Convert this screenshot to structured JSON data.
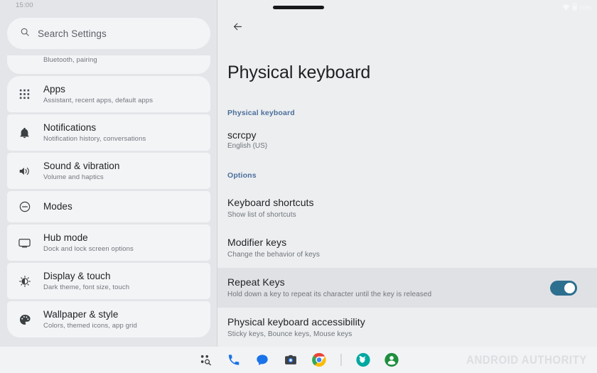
{
  "statusbar": {
    "time": "15:00",
    "battery_percent": "70%",
    "icons": [
      "wifi-icon",
      "battery-icon"
    ]
  },
  "sidebar": {
    "search": {
      "placeholder": "Search Settings",
      "icon": "search-icon"
    },
    "items": [
      {
        "id": "connected-devices",
        "icon": "bluetooth-icon",
        "title": "",
        "subtitle": "Bluetooth, pairing",
        "partial": true
      },
      {
        "id": "apps",
        "icon": "apps-grid-icon",
        "title": "Apps",
        "subtitle": "Assistant, recent apps, default apps"
      },
      {
        "id": "notifications",
        "icon": "bell-icon",
        "title": "Notifications",
        "subtitle": "Notification history, conversations"
      },
      {
        "id": "sound-vibration",
        "icon": "volume-icon",
        "title": "Sound & vibration",
        "subtitle": "Volume and haptics"
      },
      {
        "id": "modes",
        "icon": "do-not-disturb-icon",
        "title": "Modes",
        "subtitle": ""
      },
      {
        "id": "hub-mode",
        "icon": "monitor-icon",
        "title": "Hub mode",
        "subtitle": "Dock and lock screen options"
      },
      {
        "id": "display-touch",
        "icon": "brightness-icon",
        "title": "Display & touch",
        "subtitle": "Dark theme, font size, touch"
      },
      {
        "id": "wallpaper-style",
        "icon": "palette-icon",
        "title": "Wallpaper & style",
        "subtitle": "Colors, themed icons, app grid"
      }
    ]
  },
  "main": {
    "back_icon": "back-arrow-icon",
    "title": "Physical keyboard",
    "section_keyboard": {
      "header": "Physical keyboard",
      "device_name": "scrcpy",
      "device_layout": "English (US)"
    },
    "section_options": {
      "header": "Options",
      "rows": [
        {
          "id": "keyboard-shortcuts",
          "title": "Keyboard shortcuts",
          "subtitle": "Show list of shortcuts",
          "has_toggle": false,
          "highlighted": false
        },
        {
          "id": "modifier-keys",
          "title": "Modifier keys",
          "subtitle": "Change the behavior of keys",
          "has_toggle": false,
          "highlighted": false
        },
        {
          "id": "repeat-keys",
          "title": "Repeat Keys",
          "subtitle": "Hold down a key to repeat its character until the key is released",
          "has_toggle": true,
          "toggle_on": true,
          "highlighted": true
        },
        {
          "id": "physical-keyboard-accessibility",
          "title": "Physical keyboard accessibility",
          "subtitle": "Sticky keys, Bounce keys, Mouse keys",
          "has_toggle": false,
          "highlighted": false
        }
      ]
    }
  },
  "dock": {
    "items": [
      {
        "id": "app-search",
        "icon": "app-drawer-search-icon"
      },
      {
        "id": "phone",
        "icon": "phone-icon"
      },
      {
        "id": "messages",
        "icon": "messages-icon"
      },
      {
        "id": "camera",
        "icon": "camera-icon"
      },
      {
        "id": "chrome",
        "icon": "chrome-icon"
      },
      {
        "id": "divider",
        "icon": "divider"
      },
      {
        "id": "magisk",
        "icon": "magisk-icon"
      },
      {
        "id": "contacts",
        "icon": "contacts-icon"
      }
    ],
    "watermark": "ANDROID AUTHORITY"
  },
  "colors": {
    "accent_section": "#4b6f9b",
    "toggle_on": "#2d6f8e",
    "sidebar_bg": "#e3e5e8",
    "card_bg": "#f3f4f6",
    "main_bg": "#eceef0",
    "row_highlight": "#e0e1e5"
  }
}
